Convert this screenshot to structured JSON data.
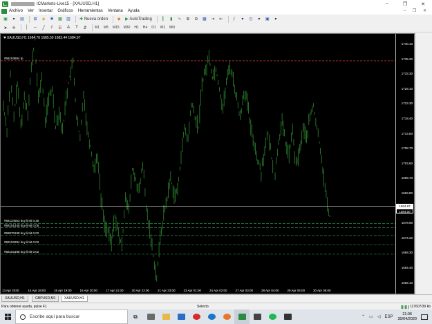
{
  "window": {
    "title": "ICMarkets-Live15 - [XAUUSD,H1]",
    "minimize": "–",
    "restore": "❐",
    "close": "✕"
  },
  "menu": {
    "items": [
      "Archivo",
      "Ver",
      "Insertar",
      "Gráficos",
      "Herramientas",
      "Ventana",
      "Ayuda"
    ],
    "right_controls": "– ❐ ✕"
  },
  "toolbar": {
    "new_order": "Nueva orden",
    "autotrading": "AutoTrading",
    "timeframes": [
      "M1",
      "M5",
      "M15",
      "M30",
      "H1",
      "H4",
      "D1",
      "W1",
      "MN"
    ]
  },
  "chart": {
    "header": "XAUUSD,H1  1684.76 1685.50 1683.44 1684.97",
    "tp_label": "#58153684 tp",
    "orders": [
      {
        "label": "#58124553 buy limit 0.35",
        "price": 1678.98
      },
      {
        "label": "#58151445 buy limit 0.05",
        "price": 1677.5
      },
      {
        "label": "#58070108 buy limit 0.02",
        "price": 1674.8
      },
      {
        "label": "#58153284 buy limit 0.02",
        "price": 1671.6
      },
      {
        "label": "#58153188 buy limit 0.02",
        "price": 1668.3
      }
    ],
    "tp_price": 1735.6,
    "bid_line": 1684.97,
    "current_price_label": "1684.97",
    "second_price_label": "1684.00",
    "y_ticks": [
      "1740.10",
      "1735.20",
      "1733.30",
      "1728.10",
      "1723.30",
      "1718.40",
      "1713.50",
      "1708.70",
      "1703.60",
      "1698.70",
      "1693.80",
      "1688.90",
      "1678.90",
      "1674.20",
      "1669.30",
      "1664.40",
      "1659.10"
    ],
    "x_ticks": [
      "13 Apr 2020",
      "14 Apr 18:00",
      "15 Apr 19:00",
      "16 Apr 20:00",
      "17 Apr 21:00",
      "20 Apr 22:00",
      "21 Apr 23:00",
      "23 Apr 01:00",
      "24 Apr 02:00",
      "27 Apr 03:00",
      "28 Apr 04:00",
      "29 Apr 05:00",
      "30 Apr 06:00"
    ],
    "colors": {
      "background": "#000000",
      "candle": "#2e8b2e",
      "tp_line": "#c0392b",
      "order_line": "#1f7a3a",
      "bid_line": "#c8c8c8"
    }
  },
  "chart_data": {
    "type": "line",
    "title": "XAUUSD,H1",
    "xlabel": "",
    "ylabel": "",
    "ylim": [
      1656.0,
      1744.0
    ],
    "series": [
      {
        "name": "XAUUSD,H1",
        "values": [
          1720,
          1712,
          1730,
          1716,
          1728,
          1713,
          1723,
          1718,
          1733,
          1743,
          1722,
          1730,
          1715,
          1722,
          1726,
          1713,
          1718,
          1711,
          1723,
          1730,
          1735,
          1716,
          1708,
          1725,
          1712,
          1706,
          1698,
          1703,
          1688,
          1679,
          1676,
          1672,
          1682,
          1675,
          1671,
          1689,
          1683,
          1698,
          1694,
          1690,
          1700,
          1684,
          1677,
          1668,
          1660,
          1674,
          1682,
          1688,
          1695,
          1689,
          1690,
          1703,
          1712,
          1708,
          1721,
          1716,
          1712,
          1728,
          1732,
          1737,
          1730,
          1733,
          1726,
          1719,
          1728,
          1734,
          1729,
          1722,
          1716,
          1725,
          1721,
          1712,
          1707,
          1701,
          1697,
          1705,
          1710,
          1702,
          1696,
          1708,
          1714,
          1707,
          1703,
          1711,
          1699,
          1704,
          1712,
          1709,
          1716,
          1720,
          1712,
          1705,
          1695,
          1685,
          1680
        ]
      }
    ],
    "grid": false
  },
  "tabs": [
    "XAUUSD,H1",
    "GBPUSD,M1",
    "XAUUSD,H1"
  ],
  "status": {
    "help": "Para obtener ayuda, pulse F1",
    "selecto": "Selecto",
    "traffic": "117607/30 kb"
  },
  "taskbar": {
    "search_placeholder": "Escribe aquí para buscar",
    "time": "21:06",
    "date": "30/04/2020",
    "tray_lang": "ESP"
  }
}
